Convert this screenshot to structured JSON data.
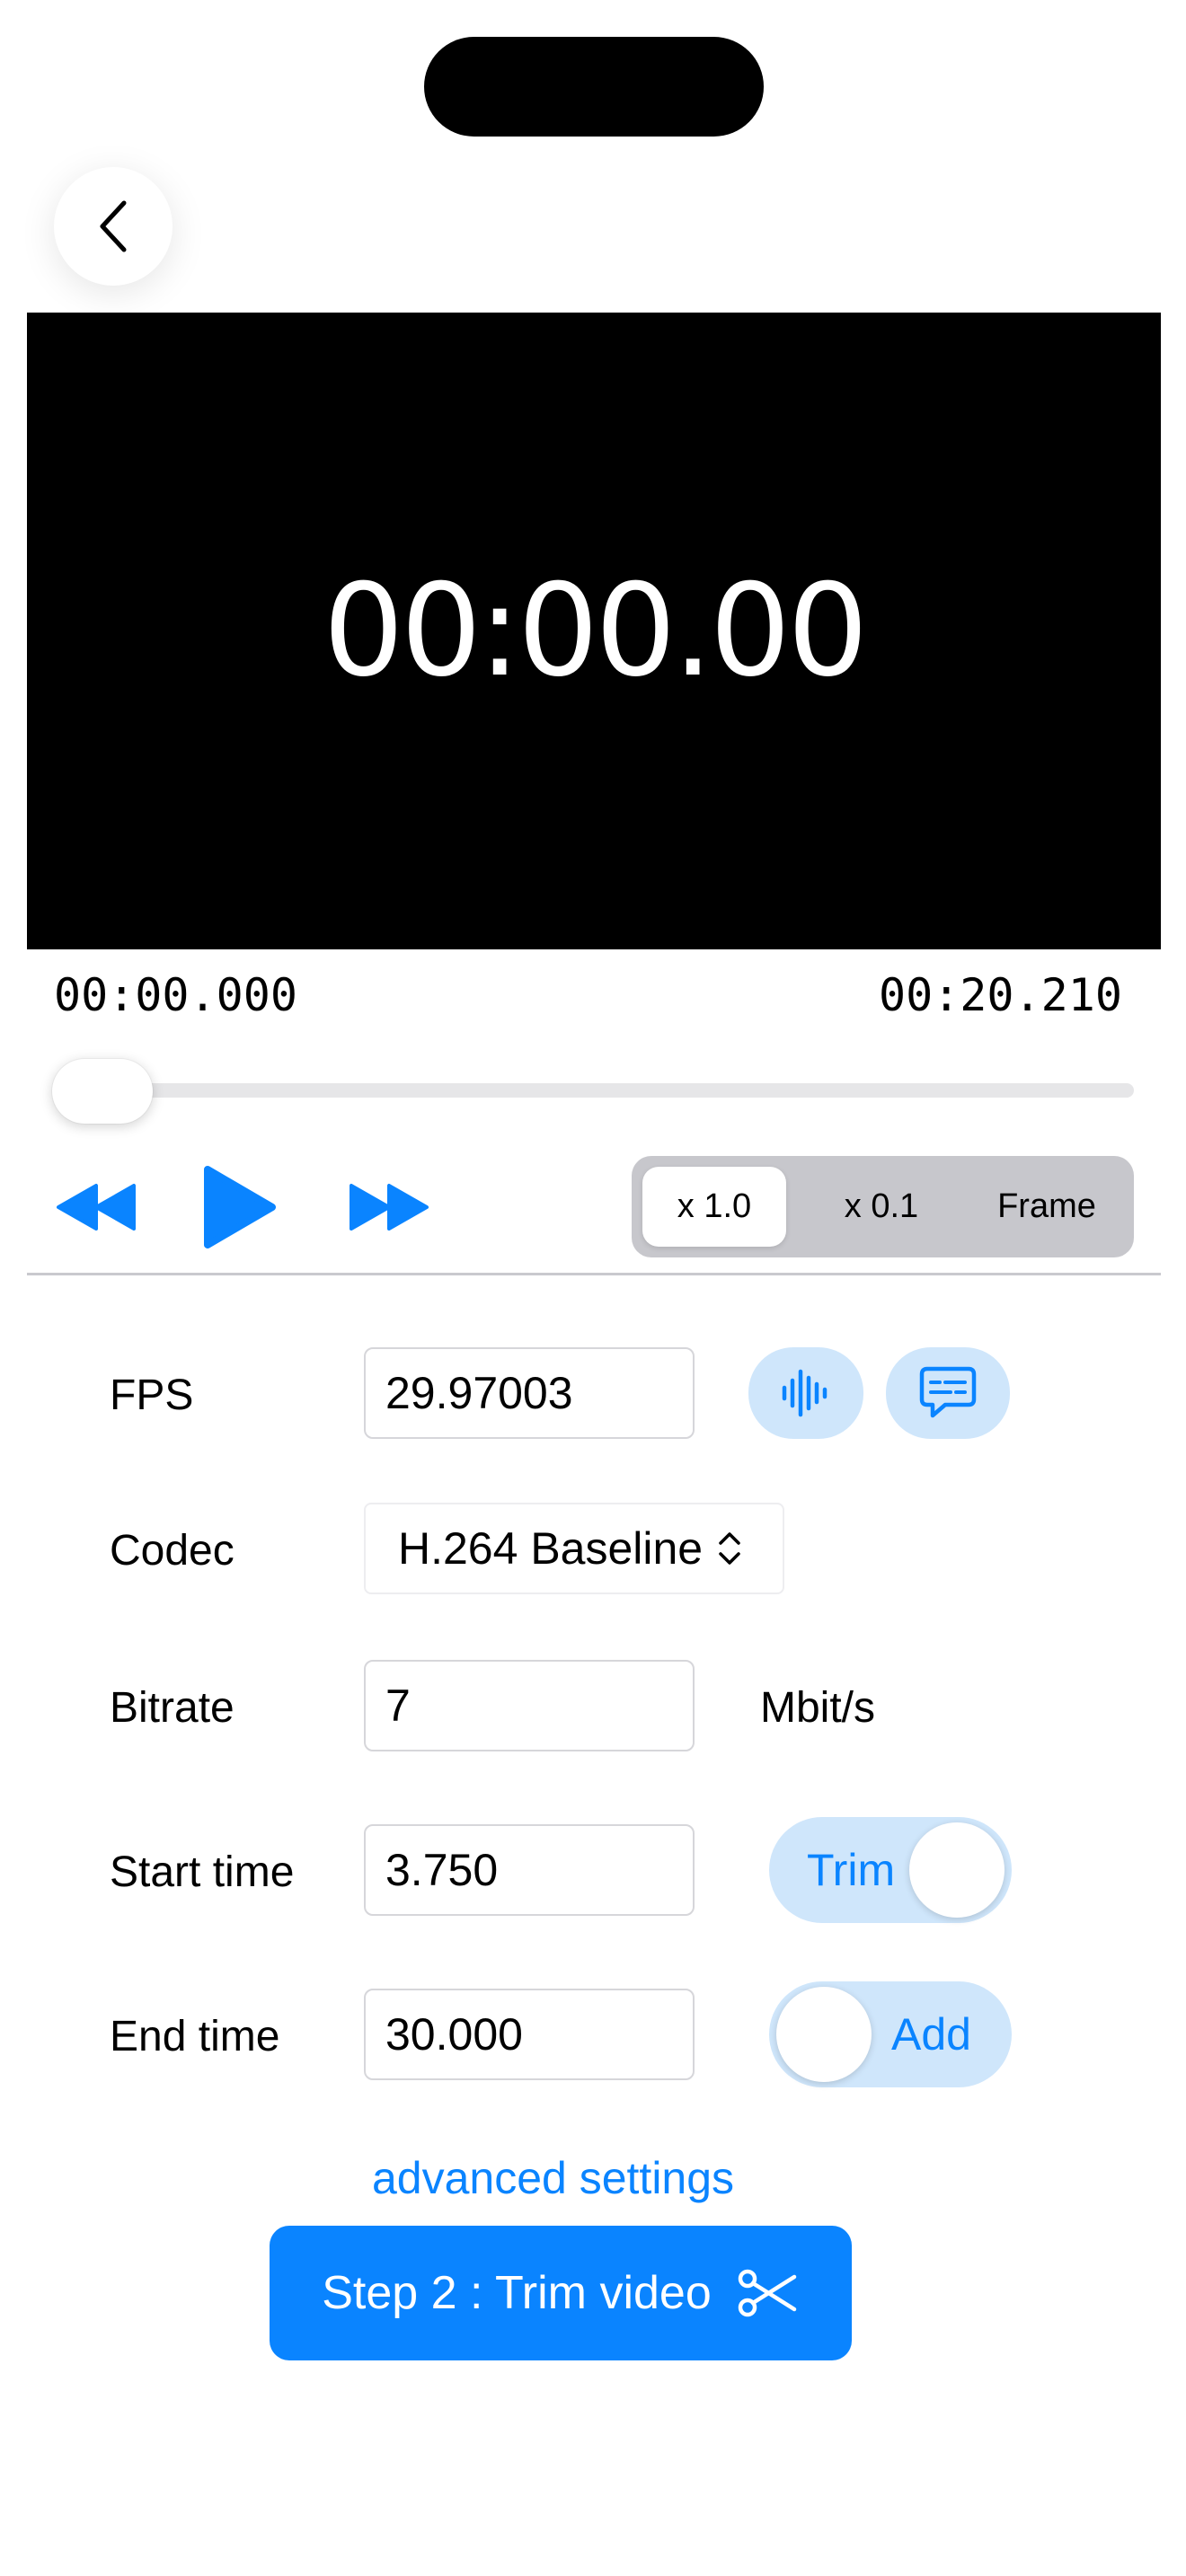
{
  "player": {
    "overlay_timecode": "00:00.00",
    "current_time": "00:00.000",
    "duration": "00:20.210",
    "scrub_position": 0.0
  },
  "speed_modes": {
    "options": [
      "x 1.0",
      "x 0.1",
      "Frame"
    ],
    "selected": "x 1.0"
  },
  "form": {
    "fps_label": "FPS",
    "fps_value": "29.97003",
    "codec_label": "Codec",
    "codec_value": "H.264 Baseline",
    "bitrate_label": "Bitrate",
    "bitrate_value": "7",
    "bitrate_unit": "Mbit/s",
    "start_label": "Start time",
    "start_value": "3.750",
    "end_label": "End time",
    "end_value": "30.000",
    "trim_toggle_label": "Trim",
    "trim_toggle_on": true,
    "add_toggle_label": "Add",
    "add_toggle_on": false
  },
  "advanced_link": "advanced settings",
  "primary_action": "Step 2 : Trim video",
  "icons": {
    "back": "chevron-left-icon",
    "rewind": "backward-icon",
    "play": "play-icon",
    "forward": "forward-icon",
    "audio": "waveform-icon",
    "subtitles": "captions-bubble-icon",
    "codec_select": "chevron-up-down-icon",
    "trim": "scissors-icon"
  },
  "colors": {
    "accent": "#0a84ff",
    "accent_light": "#cfe6fb",
    "video_bg": "#000000"
  }
}
